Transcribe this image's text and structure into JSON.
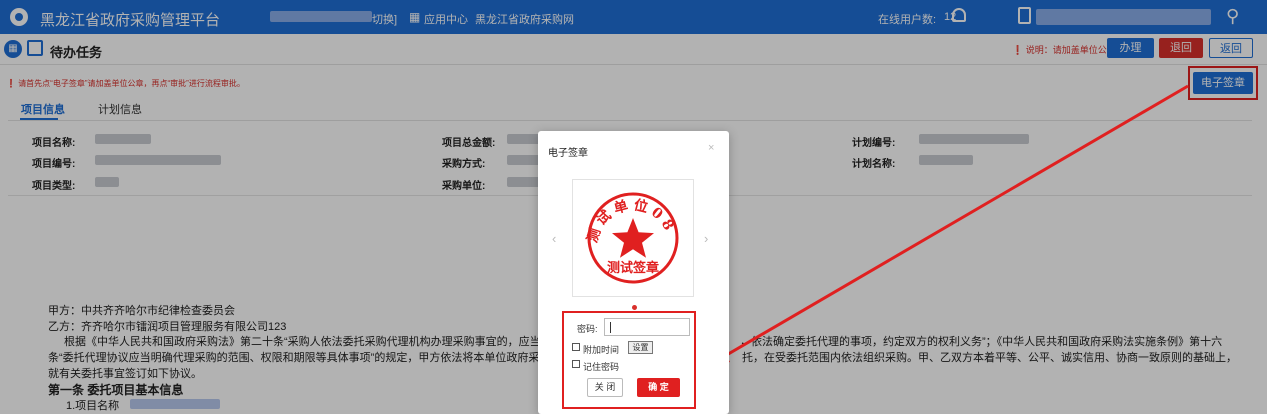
{
  "header": {
    "app_title": "黑龙江省政府采购管理平台",
    "switch_suffix": "切换]",
    "app_center": "应用中心",
    "gov_site": "黑龙江省政府采购网",
    "online_label": "在线用户数:",
    "online_count": "12"
  },
  "toolbar": {
    "page_title": "待办任务",
    "note": "说明：请加盖单位公章",
    "handle_label": "办理",
    "return_label": "退回",
    "back_label": "返回",
    "sign_label": "电子签章"
  },
  "warning": "请首先点“电子签章”请加盖单位公章，再点“审批”进行流程审批。",
  "tabs": [
    {
      "label": "项目信息",
      "active": true
    },
    {
      "label": "计划信息",
      "active": false
    }
  ],
  "fields": {
    "project_name": "项目名称:",
    "project_no": "项目编号:",
    "project_type": "项目类型:",
    "total_amount": "项目总金额:",
    "purchase_method": "采购方式:",
    "purchase_unit": "采购单位:",
    "plan_no": "计划编号:",
    "plan_name": "计划名称:"
  },
  "contract": {
    "party_a": "甲方：中共齐齐哈尔市纪律检查委员会",
    "party_b": "乙方：齐齐哈尔市镭润项目管理服务有限公司123",
    "para1_left": "根据《中华人民共和国政府采购法》第二十条“采购人依法委托采购代理机构办理采购事宜的，应当由",
    "para1_right": "，依法确定委托代理的事项，约定双方的权利义务”；《中华人民共和国政府采购法实施条例》第十六",
    "para2_left": "条“委托代理协议应当明确代理采购的范围、权限和期限等具体事项”的规定，甲方依法将本单位政府采购",
    "para2_right": "托，在受委托范围内依法组织采购。甲、乙双方本着平等、公平、诚实信用、协商一致原则的基础上，",
    "para3": "就有关委托事宜签订如下协议。",
    "article1": "第一条    委托项目基本信息",
    "item1": "1.项目名称"
  },
  "modal": {
    "title": "电子签章",
    "close_x": "×",
    "stamp_ring_text": "测试单位08",
    "stamp_bottom_text": "测试签章",
    "password_label": "密码:",
    "password_value": "",
    "attach_time_label": "附加时间",
    "attach_time_checked": false,
    "settings_label": "设置",
    "remember_label": "记住密码",
    "remember_checked": false,
    "close_label": "关 闭",
    "confirm_label": "确 定"
  },
  "colors": {
    "primary": "#1f6fd6",
    "danger": "#d9302c",
    "annotation": "#e02020"
  }
}
